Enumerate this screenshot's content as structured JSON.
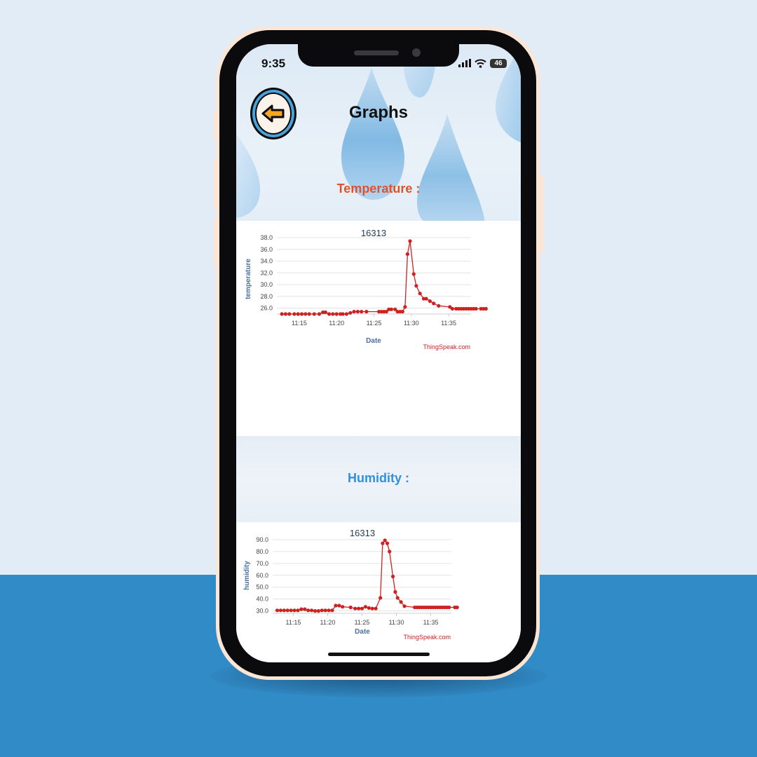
{
  "status_bar": {
    "time": "9:35",
    "battery": "46"
  },
  "header": {
    "title": "Graphs",
    "back_icon": "back-arrow-icon"
  },
  "temperature_section": {
    "label": "Temperature :"
  },
  "humidity_section": {
    "label": "Humidity :"
  },
  "colors": {
    "temperature_label": "#e0532a",
    "humidity_label": "#2f8fe0",
    "series_line": "#cc2222",
    "axis_text": "#444444",
    "axis_title": "#4a6fa0",
    "watermark": "#cc2222",
    "back_ring": "#4aa3d8",
    "back_arrow": "#f5a623",
    "bg_bottom": "#318bc6"
  },
  "chart_data": [
    {
      "type": "line",
      "title": "16313",
      "xlabel": "Date",
      "ylabel": "temperature",
      "credit": "ThingSpeak.com",
      "x_tick_labels": [
        "11:15",
        "11:20",
        "11:25",
        "11:30",
        "11:35"
      ],
      "y_tick_labels": [
        "26.0",
        "28.0",
        "30.0",
        "32.0",
        "34.0",
        "36.0",
        "38.0"
      ],
      "xlim": [
        "11:12",
        "11:38"
      ],
      "ylim": [
        25,
        38
      ],
      "grid": true,
      "legend": "none",
      "series": [
        {
          "values": [
            {
              "x": "11:12:40",
              "y": 25.0
            },
            {
              "x": "11:13:10",
              "y": 25.0
            },
            {
              "x": "11:13:40",
              "y": 25.0
            },
            {
              "x": "11:14:20",
              "y": 25.0
            },
            {
              "x": "11:14:50",
              "y": 25.0
            },
            {
              "x": "11:15:20",
              "y": 25.0
            },
            {
              "x": "11:15:50",
              "y": 25.0
            },
            {
              "x": "11:16:20",
              "y": 25.0
            },
            {
              "x": "11:17:00",
              "y": 25.0
            },
            {
              "x": "11:17:40",
              "y": 25.0
            },
            {
              "x": "11:18:10",
              "y": 25.3
            },
            {
              "x": "11:18:30",
              "y": 25.3
            },
            {
              "x": "11:19:00",
              "y": 25.0
            },
            {
              "x": "11:19:30",
              "y": 25.0
            },
            {
              "x": "11:20:00",
              "y": 25.0
            },
            {
              "x": "11:20:30",
              "y": 25.0
            },
            {
              "x": "11:20:50",
              "y": 25.0
            },
            {
              "x": "11:21:20",
              "y": 25.0
            },
            {
              "x": "11:21:50",
              "y": 25.2
            },
            {
              "x": "11:22:20",
              "y": 25.4
            },
            {
              "x": "11:22:50",
              "y": 25.4
            },
            {
              "x": "11:23:20",
              "y": 25.4
            },
            {
              "x": "11:24:00",
              "y": 25.4
            },
            {
              "x": "11:25:40",
              "y": 25.4
            },
            {
              "x": "11:26:00",
              "y": 25.4
            },
            {
              "x": "11:26:20",
              "y": 25.4
            },
            {
              "x": "11:26:40",
              "y": 25.4
            },
            {
              "x": "11:27:00",
              "y": 25.8
            },
            {
              "x": "11:27:20",
              "y": 25.8
            },
            {
              "x": "11:27:50",
              "y": 25.8
            },
            {
              "x": "11:28:10",
              "y": 25.4
            },
            {
              "x": "11:28:30",
              "y": 25.4
            },
            {
              "x": "11:28:50",
              "y": 25.4
            },
            {
              "x": "11:29:10",
              "y": 26.2
            },
            {
              "x": "11:29:30",
              "y": 35.2
            },
            {
              "x": "11:29:50",
              "y": 37.4
            },
            {
              "x": "11:30:20",
              "y": 31.8
            },
            {
              "x": "11:30:40",
              "y": 29.8
            },
            {
              "x": "11:31:10",
              "y": 28.5
            },
            {
              "x": "11:31:40",
              "y": 27.6
            },
            {
              "x": "11:32:00",
              "y": 27.6
            },
            {
              "x": "11:32:30",
              "y": 27.2
            },
            {
              "x": "11:33:00",
              "y": 26.8
            },
            {
              "x": "11:33:40",
              "y": 26.4
            },
            {
              "x": "11:35:10",
              "y": 26.2
            },
            {
              "x": "11:35:30",
              "y": 25.9
            },
            {
              "x": "11:36:00",
              "y": 25.9
            },
            {
              "x": "11:36:20",
              "y": 25.9
            },
            {
              "x": "11:36:40",
              "y": 25.9
            },
            {
              "x": "11:37:00",
              "y": 25.9
            },
            {
              "x": "11:37:20",
              "y": 25.9
            },
            {
              "x": "11:37:40",
              "y": 25.9
            },
            {
              "x": "11:38:00",
              "y": 25.9
            },
            {
              "x": "11:38:20",
              "y": 25.9
            },
            {
              "x": "11:38:40",
              "y": 25.9
            },
            {
              "x": "11:39:20",
              "y": 25.9
            },
            {
              "x": "11:39:40",
              "y": 25.9
            },
            {
              "x": "11:40:00",
              "y": 25.9
            }
          ]
        }
      ]
    },
    {
      "type": "line",
      "title": "16313",
      "xlabel": "Date",
      "ylabel": "humidity",
      "credit": "ThingSpeak.com",
      "x_tick_labels": [
        "11:15",
        "11:20",
        "11:25",
        "11:30",
        "11:35"
      ],
      "y_tick_labels": [
        "30.0",
        "40.0",
        "50.0",
        "60.0",
        "70.0",
        "80.0",
        "90.0"
      ],
      "xlim": [
        "11:12",
        "11:38"
      ],
      "ylim": [
        28,
        90
      ],
      "grid": true,
      "legend": "none",
      "series": [
        {
          "values": [
            {
              "x": "11:12:40",
              "y": 30.5
            },
            {
              "x": "11:13:10",
              "y": 30.5
            },
            {
              "x": "11:13:40",
              "y": 30.5
            },
            {
              "x": "11:14:10",
              "y": 30.5
            },
            {
              "x": "11:14:40",
              "y": 30.5
            },
            {
              "x": "11:15:10",
              "y": 30.5
            },
            {
              "x": "11:15:40",
              "y": 30.5
            },
            {
              "x": "11:16:10",
              "y": 31.5
            },
            {
              "x": "11:16:40",
              "y": 31.5
            },
            {
              "x": "11:17:10",
              "y": 30.5
            },
            {
              "x": "11:17:40",
              "y": 30.5
            },
            {
              "x": "11:18:10",
              "y": 30.0
            },
            {
              "x": "11:18:40",
              "y": 30.0
            },
            {
              "x": "11:19:10",
              "y": 30.5
            },
            {
              "x": "11:19:40",
              "y": 30.5
            },
            {
              "x": "11:20:10",
              "y": 30.5
            },
            {
              "x": "11:20:40",
              "y": 30.5
            },
            {
              "x": "11:21:10",
              "y": 34.5
            },
            {
              "x": "11:21:40",
              "y": 34.5
            },
            {
              "x": "11:22:10",
              "y": 33.5
            },
            {
              "x": "11:23:20",
              "y": 33.0
            },
            {
              "x": "11:24:00",
              "y": 32.0
            },
            {
              "x": "11:24:30",
              "y": 32.0
            },
            {
              "x": "11:25:00",
              "y": 32.0
            },
            {
              "x": "11:25:30",
              "y": 33.5
            },
            {
              "x": "11:26:00",
              "y": 32.5
            },
            {
              "x": "11:26:30",
              "y": 32.0
            },
            {
              "x": "11:27:00",
              "y": 32.0
            },
            {
              "x": "11:27:40",
              "y": 41.0
            },
            {
              "x": "11:28:00",
              "y": 87.0
            },
            {
              "x": "11:28:20",
              "y": 89.5
            },
            {
              "x": "11:28:40",
              "y": 87.0
            },
            {
              "x": "11:29:00",
              "y": 80.0
            },
            {
              "x": "11:29:30",
              "y": 59.0
            },
            {
              "x": "11:29:50",
              "y": 46.0
            },
            {
              "x": "11:30:10",
              "y": 41.0
            },
            {
              "x": "11:30:40",
              "y": 37.5
            },
            {
              "x": "11:31:10",
              "y": 34.0
            },
            {
              "x": "11:32:40",
              "y": 33.0
            },
            {
              "x": "11:33:00",
              "y": 33.0
            },
            {
              "x": "11:33:20",
              "y": 33.0
            },
            {
              "x": "11:33:40",
              "y": 33.0
            },
            {
              "x": "11:34:00",
              "y": 33.0
            },
            {
              "x": "11:34:20",
              "y": 33.0
            },
            {
              "x": "11:34:40",
              "y": 33.0
            },
            {
              "x": "11:35:00",
              "y": 33.0
            },
            {
              "x": "11:35:20",
              "y": 33.0
            },
            {
              "x": "11:35:40",
              "y": 33.0
            },
            {
              "x": "11:36:00",
              "y": 33.0
            },
            {
              "x": "11:36:20",
              "y": 33.0
            },
            {
              "x": "11:36:40",
              "y": 33.0
            },
            {
              "x": "11:37:00",
              "y": 33.0
            },
            {
              "x": "11:37:20",
              "y": 33.0
            },
            {
              "x": "11:37:40",
              "y": 33.0
            },
            {
              "x": "11:38:30",
              "y": 33.0
            },
            {
              "x": "11:38:50",
              "y": 33.0
            }
          ]
        }
      ]
    }
  ]
}
